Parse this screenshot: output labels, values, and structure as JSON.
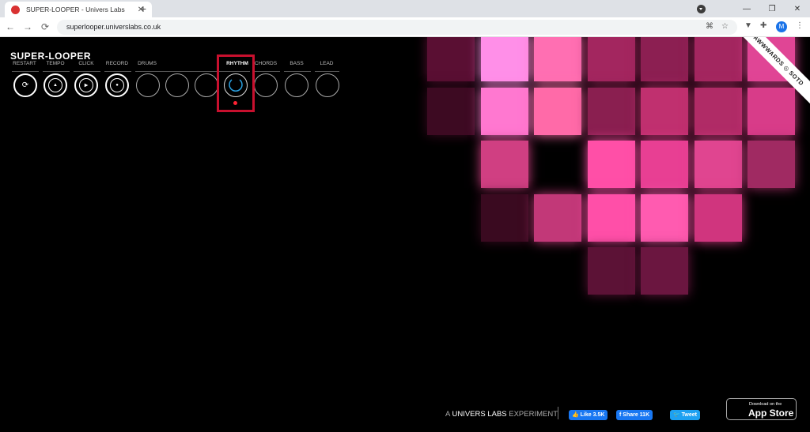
{
  "browser": {
    "tab_title": "SUPER-LOOPER - Univers Labs",
    "tab_close": "✕",
    "new_tab": "+",
    "url": "superlooper.universlabs.co.uk",
    "avatar_letter": "M",
    "nav_back": "←",
    "nav_forward": "→",
    "nav_reload": "⟳",
    "win_minimize": "—",
    "win_restore": "❐",
    "win_close": "✕",
    "translate_icon": "⌘",
    "bookmark_icon": "☆",
    "menu_icon": "⋮"
  },
  "app": {
    "logo": "SUPER-LOOPER",
    "controls": [
      {
        "label": "RESTART",
        "glyph": "⟳"
      },
      {
        "label": "TEMPO",
        "glyph": "▲"
      },
      {
        "label": "CLICK",
        "glyph": "▶"
      },
      {
        "label": "RECORD",
        "glyph": "●"
      },
      {
        "label": "DRUMS"
      },
      {
        "label": "RHYTHM",
        "active": true
      },
      {
        "label": "CHORDS"
      },
      {
        "label": "BASS"
      },
      {
        "label": "LEAD"
      }
    ]
  },
  "grid": {
    "cells": [
      {
        "c": 0,
        "r": 0,
        "color": "#5a0f33"
      },
      {
        "c": 1,
        "r": 0,
        "color": "#ff8fe8"
      },
      {
        "c": 2,
        "r": 0,
        "color": "#ff6fb2"
      },
      {
        "c": 3,
        "r": 0,
        "color": "#a3265f"
      },
      {
        "c": 4,
        "r": 0,
        "color": "#8c1f52"
      },
      {
        "c": 5,
        "r": 0,
        "color": "#a3265f"
      },
      {
        "c": 6,
        "r": 0,
        "color": "#e04595"
      },
      {
        "c": 0,
        "r": 1,
        "color": "#3d0a22"
      },
      {
        "c": 1,
        "r": 1,
        "color": "#ff78d0"
      },
      {
        "c": 2,
        "r": 1,
        "color": "#ff6aa8"
      },
      {
        "c": 3,
        "r": 1,
        "color": "#8a1f50"
      },
      {
        "c": 4,
        "r": 1,
        "color": "#c0306f"
      },
      {
        "c": 5,
        "r": 1,
        "color": "#b02b66"
      },
      {
        "c": 6,
        "r": 1,
        "color": "#d83c89"
      },
      {
        "c": 1,
        "r": 2,
        "color": "#d03f82"
      },
      {
        "c": 3,
        "r": 2,
        "color": "#ff4fa7"
      },
      {
        "c": 4,
        "r": 2,
        "color": "#e83f93"
      },
      {
        "c": 5,
        "r": 2,
        "color": "#e04590"
      },
      {
        "c": 6,
        "r": 2,
        "color": "#a02a62"
      },
      {
        "c": 1,
        "r": 3,
        "color": "#3a0a20"
      },
      {
        "c": 2,
        "r": 3,
        "color": "#c23878"
      },
      {
        "c": 3,
        "r": 3,
        "color": "#ff4fa8"
      },
      {
        "c": 4,
        "r": 3,
        "color": "#ff5bb0"
      },
      {
        "c": 5,
        "r": 3,
        "color": "#d0357e"
      },
      {
        "c": 3,
        "r": 4,
        "color": "#5c1236"
      },
      {
        "c": 4,
        "r": 4,
        "color": "#6b1640"
      }
    ]
  },
  "ribbon": "AWWWARDS ◎ SOTD",
  "footer": {
    "credit_a": "A ",
    "credit_brand": "UNIVERS LABS",
    "credit_b": " EXPERIMENT",
    "fb_like": "👍 Like 3.5K",
    "fb_share": "f Share 11K",
    "tweet": "🐦 Tweet",
    "appstore_small": "Download on the",
    "appstore_big": "App Store",
    "apple_glyph": ""
  }
}
